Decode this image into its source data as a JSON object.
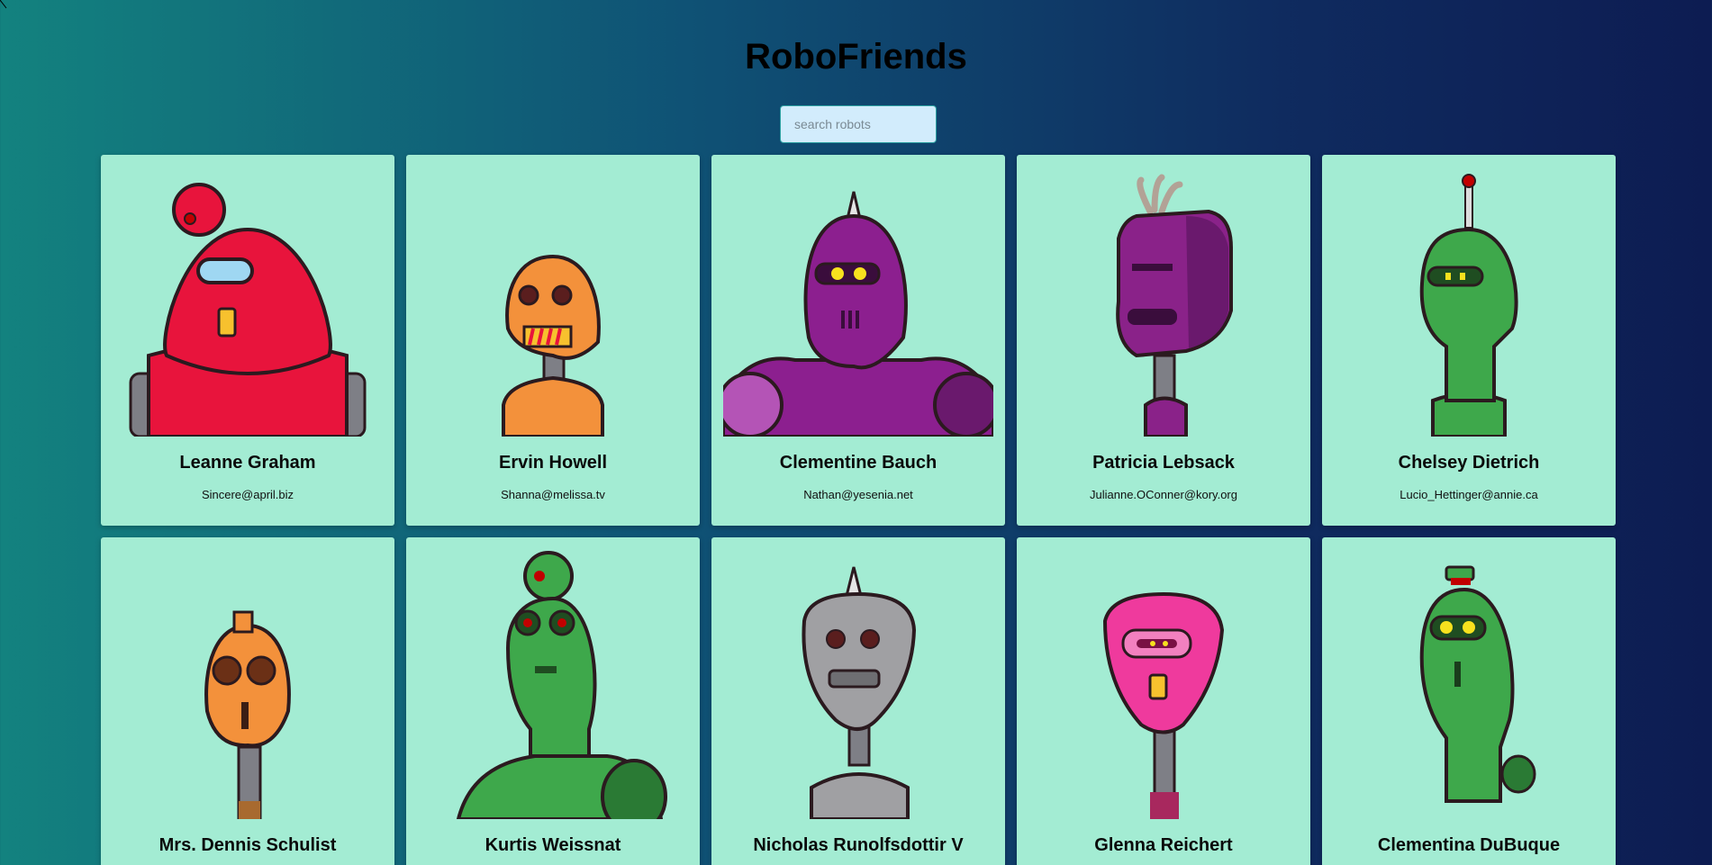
{
  "app": {
    "title": "RoboFriends"
  },
  "search": {
    "placeholder": "search robots",
    "value": ""
  },
  "robots": [
    {
      "name": "Leanne Graham",
      "email": "Sincere@april.biz",
      "color": "#e8143c"
    },
    {
      "name": "Ervin Howell",
      "email": "Shanna@melissa.tv",
      "color": "#f3913b"
    },
    {
      "name": "Clementine Bauch",
      "email": "Nathan@yesenia.net",
      "color": "#8c1f8f"
    },
    {
      "name": "Patricia Lebsack",
      "email": "Julianne.OConner@kory.org",
      "color": "#8a2289"
    },
    {
      "name": "Chelsey Dietrich",
      "email": "Lucio_Hettinger@annie.ca",
      "color": "#3ea84b"
    },
    {
      "name": "Mrs. Dennis Schulist",
      "email": "",
      "color": "#f3913b"
    },
    {
      "name": "Kurtis Weissnat",
      "email": "",
      "color": "#3ea84b"
    },
    {
      "name": "Nicholas Runolfsdottir V",
      "email": "",
      "color": "#a0a0a3"
    },
    {
      "name": "Glenna Reichert",
      "email": "",
      "color": "#ef3a9d"
    },
    {
      "name": "Clementina DuBuque",
      "email": "",
      "color": "#3ea84b"
    }
  ]
}
